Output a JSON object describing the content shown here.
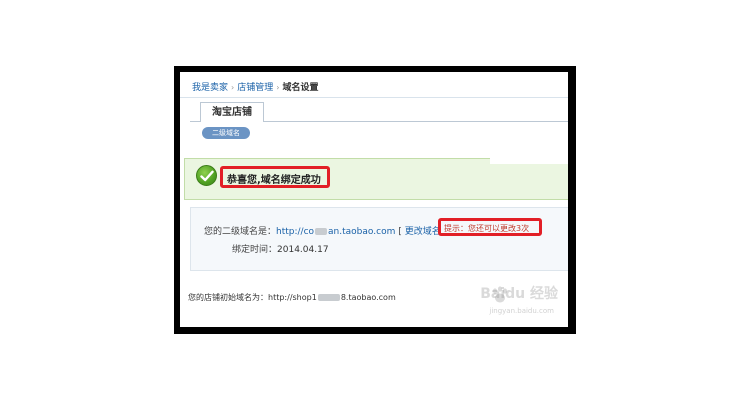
{
  "breadcrumb": {
    "items": [
      "我是卖家",
      "店铺管理"
    ],
    "separator": "›",
    "current": "域名设置"
  },
  "tab": {
    "label": "淘宝店铺"
  },
  "subtab": {
    "label": "二级域名"
  },
  "success": {
    "message": "恭喜您,域名绑定成功"
  },
  "info": {
    "domain_label": "您的二级域名是：",
    "domain_prefix": "http://co",
    "domain_suffix": "an.taobao.com",
    "bracket_open": "[",
    "change_label": "更改域名",
    "tip": "提示：您还可以更改3次",
    "bind_time_label": "绑定时间：",
    "bind_time_value": "2014.04.17"
  },
  "footer": {
    "initial_domain_label": "您的店铺初始域名为：",
    "domain_prefix": "http://shop1",
    "domain_suffix": "8.taobao.com"
  },
  "watermark": {
    "text": "Baidu 经验",
    "sub": "jingyan.baidu.com"
  },
  "colors": {
    "link": "#1b62a8",
    "highlight": "#e21f26",
    "success_bg": "#ebf6e1",
    "success_icon": "#4fa022"
  }
}
